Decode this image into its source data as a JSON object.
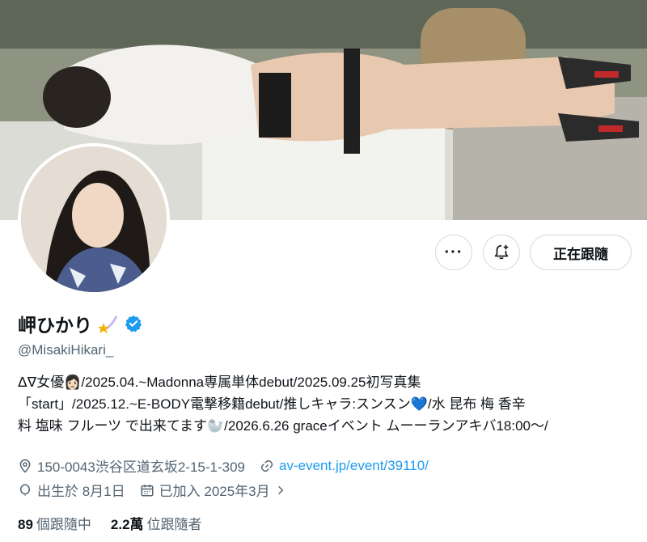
{
  "profile": {
    "display_name": "岬ひかり",
    "handle": "@MisakiHikari_",
    "bio_lines": [
      "ᐃᐁ女優👩🏻/2025.04.~Madonna専属単体debut/2025.09.25初写真集",
      "「start」/2025.12.~E-BODY電撃移籍debut/推しキャラ:スンスン💙/水 昆布 梅 香辛",
      "料 塩味 フルーツ で出来てます🦭/2026.6.26 graceイベント ムーーランアキバ18:00～/"
    ],
    "location": "150-0043渋谷区道玄坂2-15-1-309",
    "website": "av-event.jp/event/39110/",
    "birthday": "出生於 8月1日",
    "joined": "已加入 2025年3月",
    "following_count": "89",
    "following_label": "個跟隨中",
    "followers_count": "2.2萬",
    "followers_label": "位跟隨者"
  },
  "actions": {
    "more_label": "···",
    "follow_label": "正在跟隨"
  },
  "colors": {
    "accent": "#1d9bf0",
    "verified": "#1d9bf0",
    "secondary_text": "#536471",
    "border": "#cfd9de"
  },
  "icons": [
    "more-icon",
    "add-notification-icon",
    "verified-badge-icon",
    "shooting-star-emoji",
    "location-icon",
    "link-icon",
    "birthday-icon",
    "calendar-icon",
    "chevron-right-icon"
  ]
}
